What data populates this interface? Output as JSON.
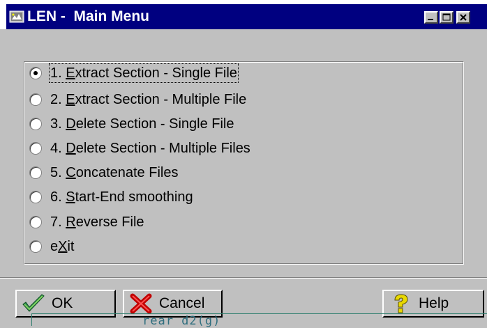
{
  "window": {
    "title": "LEN -  Main Menu",
    "titlebar_color": "#000080",
    "controls": [
      "minimize-icon",
      "maximize-icon",
      "close-icon"
    ]
  },
  "menu": {
    "options": [
      {
        "pre": "1. ",
        "key": "E",
        "post": "xtract Section - Single File",
        "selected": true
      },
      {
        "pre": "2. ",
        "key": "E",
        "post": "xtract Section - Multiple File",
        "selected": false
      },
      {
        "pre": "3. ",
        "key": "D",
        "post": "elete Section - Single File",
        "selected": false
      },
      {
        "pre": "4. ",
        "key": "D",
        "post": "elete Section - Multiple Files",
        "selected": false
      },
      {
        "pre": "5. ",
        "key": "C",
        "post": "oncatenate Files",
        "selected": false
      },
      {
        "pre": "6. ",
        "key": "S",
        "post": "tart-End smoothing",
        "selected": false
      },
      {
        "pre": "7. ",
        "key": "R",
        "post": "everse File",
        "selected": false
      },
      {
        "pre": "e",
        "key": "X",
        "post": "it",
        "selected": false
      }
    ]
  },
  "buttons": {
    "ok": {
      "label": "OK",
      "icon": "checkmark-icon"
    },
    "cancel": {
      "label": "Cancel",
      "icon": "x-icon"
    },
    "help": {
      "label": "Help",
      "icon": "question-icon"
    }
  },
  "overlay_text": "rear d2(g)"
}
